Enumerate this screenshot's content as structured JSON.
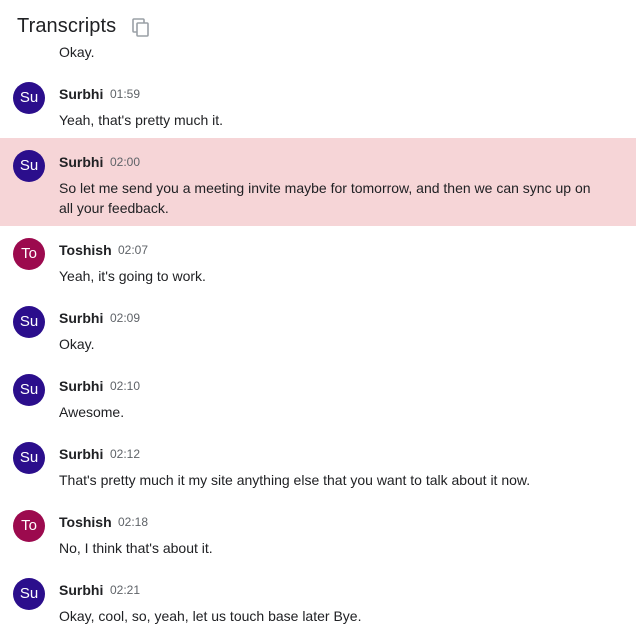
{
  "header": {
    "title": "Transcripts",
    "copy_icon": "copy-icon"
  },
  "partial_previous_text": "Okay.",
  "colors": {
    "avatar_su": "#2b0e8c",
    "avatar_to": "#9c0a4e",
    "highlight": "#f6d5d7"
  },
  "entries": [
    {
      "initials": "Su",
      "speaker": "Surbhi",
      "time": "01:59",
      "text": "Yeah, that's pretty much it."
    },
    {
      "initials": "Su",
      "speaker": "Surbhi",
      "time": "02:00",
      "text": "So let me send you a meeting invite maybe for tomorrow, and then we can sync up on all your feedback.",
      "highlighted": true
    },
    {
      "initials": "To",
      "speaker": "Toshish",
      "time": "02:07",
      "text": "Yeah, it's going to work."
    },
    {
      "initials": "Su",
      "speaker": "Surbhi",
      "time": "02:09",
      "text": "Okay."
    },
    {
      "initials": "Su",
      "speaker": "Surbhi",
      "time": "02:10",
      "text": "Awesome."
    },
    {
      "initials": "Su",
      "speaker": "Surbhi",
      "time": "02:12",
      "text": "That's pretty much it my site anything else that you want to talk about it now."
    },
    {
      "initials": "To",
      "speaker": "Toshish",
      "time": "02:18",
      "text": "No, I think that's about it."
    },
    {
      "initials": "Su",
      "speaker": "Surbhi",
      "time": "02:21",
      "text": "Okay, cool, so, yeah, let us touch base later Bye."
    }
  ]
}
